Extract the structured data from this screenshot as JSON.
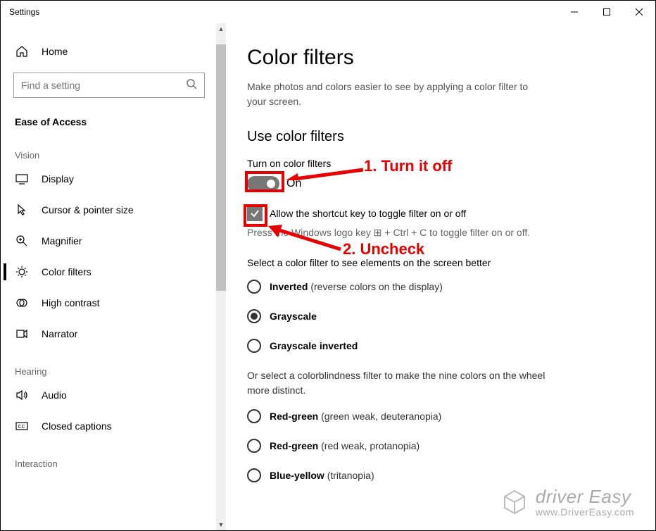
{
  "window": {
    "title": "Settings"
  },
  "sidebar": {
    "home_label": "Home",
    "search_placeholder": "Find a setting",
    "section_title": "Ease of Access",
    "groups": [
      {
        "label": "Vision",
        "items": [
          {
            "id": "display",
            "label": "Display",
            "icon": "display-icon"
          },
          {
            "id": "cursor",
            "label": "Cursor & pointer size",
            "icon": "cursor-icon"
          },
          {
            "id": "magnifier",
            "label": "Magnifier",
            "icon": "magnifier-icon"
          },
          {
            "id": "color-filters",
            "label": "Color filters",
            "icon": "color-filters-icon",
            "active": true
          },
          {
            "id": "high-contrast",
            "label": "High contrast",
            "icon": "high-contrast-icon"
          },
          {
            "id": "narrator",
            "label": "Narrator",
            "icon": "narrator-icon"
          }
        ]
      },
      {
        "label": "Hearing",
        "items": [
          {
            "id": "audio",
            "label": "Audio",
            "icon": "audio-icon"
          },
          {
            "id": "closed-captions",
            "label": "Closed captions",
            "icon": "closed-captions-icon"
          }
        ]
      },
      {
        "label": "Interaction",
        "items": []
      }
    ]
  },
  "main": {
    "heading": "Color filters",
    "subtitle": "Make photos and colors easier to see by applying a color filter to your screen.",
    "section_heading": "Use color filters",
    "toggle_label": "Turn on color filters",
    "toggle_state_label": "On",
    "toggle_on": true,
    "checkbox_label": "Allow the shortcut key to toggle filter on or off",
    "checkbox_checked": true,
    "shortcut_hint_prefix": "Press the Windows logo key ",
    "shortcut_hint_suffix": " + Ctrl + C to toggle filter on or off.",
    "filter_instruction": "Select a color filter to see elements on the screen better",
    "filter_options": [
      {
        "label": "Inverted",
        "paren": "(reverse colors on the display)",
        "selected": false
      },
      {
        "label": "Grayscale",
        "paren": "",
        "selected": true
      },
      {
        "label": "Grayscale inverted",
        "paren": "",
        "selected": false
      }
    ],
    "colorblind_instruction": "Or select a colorblindness filter to make the nine colors on the wheel more distinct.",
    "colorblind_options": [
      {
        "label": "Red-green",
        "paren": "(green weak, deuteranopia)"
      },
      {
        "label": "Red-green",
        "paren": "(red weak, protanopia)"
      },
      {
        "label": "Blue-yellow",
        "paren": "(tritanopia)"
      }
    ]
  },
  "annotations": {
    "step1": "1. Turn it off",
    "step2": "2. Uncheck"
  },
  "watermark": {
    "brand_prefix": "driver ",
    "brand_suffix": "Easy",
    "url": "www.DriverEasy.com"
  }
}
